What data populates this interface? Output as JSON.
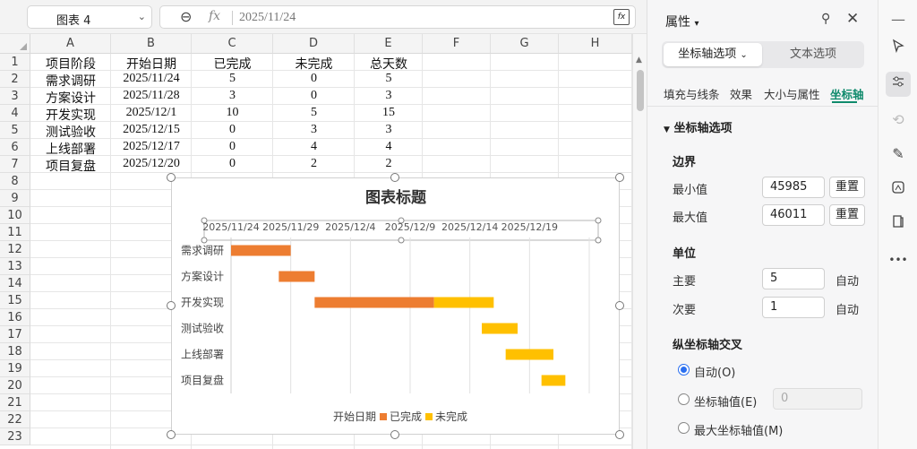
{
  "formula_bar": {
    "name_box": "图表 4",
    "zoom_icon": "⊖",
    "fx_symbol": "fx",
    "value": "2025/11/24",
    "fx_button": "fx"
  },
  "grid": {
    "columns": [
      "A",
      "B",
      "C",
      "D",
      "E",
      "F",
      "G",
      "H"
    ],
    "rows": [
      "1",
      "2",
      "3",
      "4",
      "5",
      "6",
      "7",
      "8",
      "9",
      "10",
      "11",
      "12",
      "13",
      "14",
      "15",
      "16",
      "17",
      "18",
      "19",
      "20",
      "21",
      "22",
      "23"
    ],
    "header": [
      "项目阶段",
      "开始日期",
      "已完成",
      "未完成",
      "总天数"
    ],
    "data": [
      [
        "需求调研",
        "2025/11/24",
        "5",
        "0",
        "5"
      ],
      [
        "方案设计",
        "2025/11/28",
        "3",
        "0",
        "3"
      ],
      [
        "开发实现",
        "2025/12/1",
        "10",
        "5",
        "15"
      ],
      [
        "测试验收",
        "2025/12/15",
        "0",
        "3",
        "3"
      ],
      [
        "上线部署",
        "2025/12/17",
        "0",
        "4",
        "4"
      ],
      [
        "项目复盘",
        "2025/12/20",
        "0",
        "2",
        "2"
      ]
    ]
  },
  "chart_data": {
    "type": "bar",
    "orientation": "horizontal-stacked",
    "title": "图表标题",
    "categories": [
      "需求调研",
      "方案设计",
      "开发实现",
      "测试验收",
      "上线部署",
      "项目复盘"
    ],
    "series": [
      {
        "name": "开始日期",
        "values": [
          "2025/11/24",
          "2025/11/28",
          "2025/12/1",
          "2025/12/15",
          "2025/12/17",
          "2025/12/20"
        ],
        "hidden": true
      },
      {
        "name": "已完成",
        "values": [
          5,
          3,
          10,
          0,
          0,
          0
        ],
        "color": "#ed7d31"
      },
      {
        "name": "未完成",
        "values": [
          0,
          0,
          5,
          3,
          4,
          2
        ],
        "color": "#ffc000"
      }
    ],
    "x_ticks": [
      "2025/11/24",
      "2025/11/29",
      "2025/12/4",
      "2025/12/9",
      "2025/12/14",
      "2025/12/19"
    ],
    "x_range": [
      "2025/11/24",
      "2025/12/24"
    ],
    "x_axis_position": "top",
    "grid": true,
    "legend_position": "bottom"
  },
  "panel": {
    "title": "属性",
    "title_caret": "▾",
    "pin_icon": "⚲",
    "close_icon": "✕",
    "seg_active": "坐标轴选项",
    "seg_inactive": "文本选项",
    "subtabs": [
      "填充与线条",
      "效果",
      "大小与属性",
      "坐标轴"
    ],
    "section_title": "坐标轴选项",
    "bounds": {
      "heading": "边界",
      "min_label": "最小值",
      "min_value": "45985",
      "max_label": "最大值",
      "max_value": "46011",
      "reset": "重置"
    },
    "units": {
      "heading": "单位",
      "major_label": "主要",
      "major_value": "5",
      "minor_label": "次要",
      "minor_value": "1",
      "auto": "自动"
    },
    "cross": {
      "heading": "纵坐标轴交叉",
      "opt_auto": "自动(O)",
      "opt_value": "坐标轴值(E)",
      "opt_value_input": "0",
      "opt_max": "最大坐标轴值(M)"
    }
  },
  "toolbar": {
    "items": [
      "minus-icon",
      "cursor-icon",
      "sliders-icon",
      "crop-icon",
      "brush-icon",
      "chart-style-icon",
      "book-icon",
      "more-icon"
    ],
    "more": "•••"
  },
  "colors": {
    "accent": "#0f8a6c",
    "orange": "#ed7d31",
    "gold": "#ffc000",
    "radio": "#2a6ff0"
  }
}
